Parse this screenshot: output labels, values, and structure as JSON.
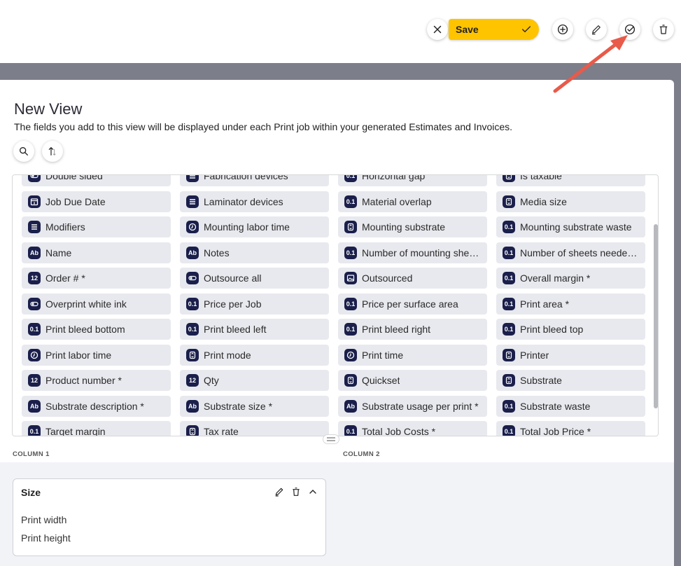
{
  "toolbar": {
    "save_label": "Save",
    "accent_color": "#ffc400",
    "icons": [
      "close-icon",
      "checkmark-icon",
      "add-circle-icon",
      "pencil-icon",
      "check-circle-icon",
      "trash-icon"
    ]
  },
  "view": {
    "title": "New View",
    "description": "The fields you add to this view will be displayed under each Print job within your generated Estimates and Invoices."
  },
  "fields": [
    [
      {
        "label": "Double sided",
        "icon": "toggle"
      },
      {
        "label": "Job Due Date",
        "icon": "calendar"
      },
      {
        "label": "Modifiers",
        "icon": "stack"
      },
      {
        "label": "Name",
        "icon": "Ab"
      },
      {
        "label": "Order # *",
        "icon": "12"
      },
      {
        "label": "Overprint white ink",
        "icon": "toggle"
      },
      {
        "label": "Print bleed bottom",
        "icon": "0.1"
      },
      {
        "label": "Print labor time",
        "icon": "clock"
      },
      {
        "label": "Product number *",
        "icon": "12"
      },
      {
        "label": "Substrate description *",
        "icon": "Ab"
      },
      {
        "label": "Target margin",
        "icon": "0.1"
      }
    ],
    [
      {
        "label": "Fabrication devices",
        "icon": "stack"
      },
      {
        "label": "Laminator devices",
        "icon": "stack"
      },
      {
        "label": "Mounting labor time",
        "icon": "clock"
      },
      {
        "label": "Notes",
        "icon": "Ab"
      },
      {
        "label": "Outsource all",
        "icon": "toggle"
      },
      {
        "label": "Price per Job",
        "icon": "0.1"
      },
      {
        "label": "Print bleed left",
        "icon": "0.1"
      },
      {
        "label": "Print mode",
        "icon": "select"
      },
      {
        "label": "Qty",
        "icon": "12"
      },
      {
        "label": "Substrate size *",
        "icon": "Ab"
      },
      {
        "label": "Tax rate",
        "icon": "select"
      }
    ],
    [
      {
        "label": "Horizontal gap",
        "icon": "0.1"
      },
      {
        "label": "Material overlap",
        "icon": "0.1"
      },
      {
        "label": "Mounting substrate",
        "icon": "select"
      },
      {
        "label": "Number of mounting she…",
        "icon": "0.1"
      },
      {
        "label": "Outsourced",
        "icon": "image"
      },
      {
        "label": "Price per surface area",
        "icon": "0.1"
      },
      {
        "label": "Print bleed right",
        "icon": "0.1"
      },
      {
        "label": "Print time",
        "icon": "clock"
      },
      {
        "label": "Quickset",
        "icon": "select"
      },
      {
        "label": "Substrate usage per print *",
        "icon": "Ab"
      },
      {
        "label": "Total Job Costs *",
        "icon": "0.1"
      }
    ],
    [
      {
        "label": "Is taxable",
        "icon": "select"
      },
      {
        "label": "Media size",
        "icon": "select"
      },
      {
        "label": "Mounting substrate waste",
        "icon": "0.1"
      },
      {
        "label": "Number of sheets neede…",
        "icon": "0.1"
      },
      {
        "label": "Overall margin *",
        "icon": "0.1"
      },
      {
        "label": "Print area *",
        "icon": "0.1"
      },
      {
        "label": "Print bleed top",
        "icon": "0.1"
      },
      {
        "label": "Printer",
        "icon": "select"
      },
      {
        "label": "Substrate",
        "icon": "select"
      },
      {
        "label": "Substrate waste",
        "icon": "0.1"
      },
      {
        "label": "Total Job Price *",
        "icon": "0.1"
      }
    ]
  ],
  "columns": {
    "col1_label": "COLUMN 1",
    "col2_label": "COLUMN 2"
  },
  "card": {
    "title": "Size",
    "items": [
      "Print width",
      "Print height"
    ]
  }
}
